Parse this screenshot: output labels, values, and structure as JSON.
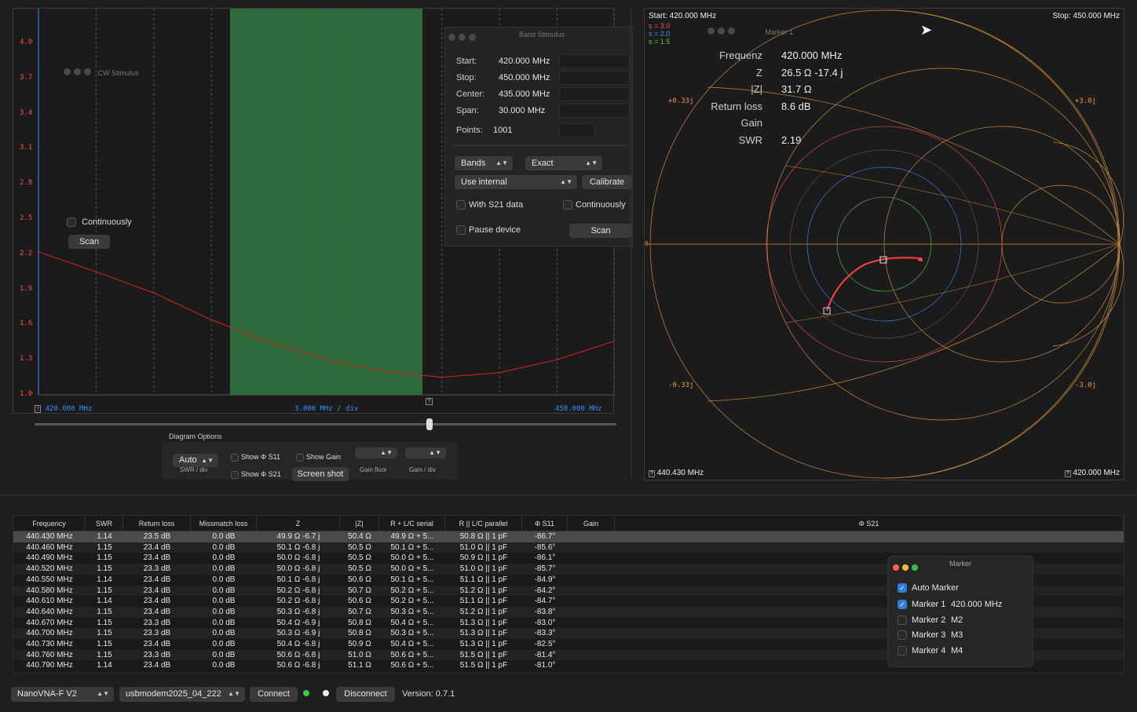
{
  "swr_chart": {
    "y_ticks": [
      "4.0",
      "3.7",
      "3.4",
      "3.1",
      "2.8",
      "2.5",
      "2.2",
      "1.9",
      "1.6",
      "1.3",
      "1.0"
    ],
    "start_label": "420.000 MHz",
    "div_label": "3.000 MHz / div",
    "stop_label": "450.000 MHz",
    "marker_glyph": "?",
    "trace_color": "#e02020",
    "band_color": "#2e6b3a"
  },
  "cw_stimulus": {
    "title": "CW Stimulus",
    "continuously_label": "Continuously",
    "scan_label": "Scan"
  },
  "band_stimulus": {
    "title": "Band Stimulus",
    "start_label": "Start:",
    "start_value": "420.000 MHz",
    "stop_label": "Stop:",
    "stop_value": "450.000 MHz",
    "center_label": "Center:",
    "center_value": "435.000 MHz",
    "span_label": "Span:",
    "span_value": "30.000 MHz",
    "points_label": "Points:",
    "points_value": "1001",
    "bands_select": "Bands",
    "exact_select": "Exact",
    "cal_select": "Use internal",
    "calibrate_label": "Calibrate",
    "s21_label": "With S21 data",
    "continuously_label": "Continuously",
    "pause_label": "Pause device",
    "scan_label": "Scan"
  },
  "diagram_options": {
    "title": "Diagram Options",
    "swr_select": "Auto",
    "swr_caption": "SWR / div",
    "show_s11": "Show Φ S11",
    "show_s21": "Show Φ S21",
    "show_gain": "Show Gain",
    "screenshot_label": "Screen shot",
    "gain_floor_caption": "Gain floor",
    "gain_div_caption": "Gain / div"
  },
  "smith": {
    "start_text": "Start: 420.000 MHz",
    "stop_text": "Stop: 450.000 MHz",
    "s_circles": [
      "s = 3.0",
      "s = 2.0",
      "s = 1.5"
    ],
    "s_colors": [
      "#ff5050",
      "#3d8cff",
      "#4ccf4c"
    ],
    "ticks": [
      "+0.33j",
      "+3.0j",
      "-0.33j",
      "-3.0j",
      "0"
    ],
    "bottom_left": "440.430 MHz",
    "bottom_right": "420.000 MHz",
    "marker_window_title": "Marker 1",
    "readout": [
      {
        "label": "Frequenz",
        "value": "420.000 MHz"
      },
      {
        "label": "Z",
        "value": "26.5 Ω -17.4 j"
      },
      {
        "label": "|Z|",
        "value": "31.7 Ω"
      },
      {
        "label": "Return loss",
        "value": "8.6 dB"
      },
      {
        "label": "Gain",
        "value": ""
      },
      {
        "label": "SWR",
        "value": "2.19"
      }
    ]
  },
  "table": {
    "headers": [
      "Frequency",
      "SWR",
      "Return loss",
      "Missmatch loss",
      "Z",
      "|Z|",
      "R + L/C serial",
      "R || L/C parallel",
      "Φ S11",
      "Gain",
      "Φ S21"
    ],
    "rows": [
      [
        "440.430 MHz",
        "1.14",
        "23.5 dB",
        "0.0 dB",
        "49.9 Ω -6.7 j",
        "50.4 Ω",
        "49.9 Ω + 5...",
        "50.8 Ω || 1 pF",
        "-86.7°"
      ],
      [
        "440.460 MHz",
        "1.15",
        "23.4 dB",
        "0.0 dB",
        "50.1 Ω -6.8 j",
        "50.5 Ω",
        "50.1 Ω + 5...",
        "51.0 Ω || 1 pF",
        "-85.6°"
      ],
      [
        "440.490 MHz",
        "1.15",
        "23.4 dB",
        "0.0 dB",
        "50.0 Ω -6.8 j",
        "50.5 Ω",
        "50.0 Ω + 5...",
        "50.9 Ω || 1 pF",
        "-86.1°"
      ],
      [
        "440.520 MHz",
        "1.15",
        "23.3 dB",
        "0.0 dB",
        "50.0 Ω -6.8 j",
        "50.5 Ω",
        "50.0 Ω + 5...",
        "51.0 Ω || 1 pF",
        "-85.7°"
      ],
      [
        "440.550 MHz",
        "1.14",
        "23.4 dB",
        "0.0 dB",
        "50.1 Ω -6.8 j",
        "50.6 Ω",
        "50.1 Ω + 5...",
        "51.1 Ω || 1 pF",
        "-84.9°"
      ],
      [
        "440.580 MHz",
        "1.15",
        "23.4 dB",
        "0.0 dB",
        "50.2 Ω -6.8 j",
        "50.7 Ω",
        "50.2 Ω + 5...",
        "51.2 Ω || 1 pF",
        "-84.2°"
      ],
      [
        "440.610 MHz",
        "1.14",
        "23.4 dB",
        "0.0 dB",
        "50.2 Ω -6.8 j",
        "50.6 Ω",
        "50.2 Ω + 5...",
        "51.1 Ω || 1 pF",
        "-84.7°"
      ],
      [
        "440.640 MHz",
        "1.15",
        "23.4 dB",
        "0.0 dB",
        "50.3 Ω -6.8 j",
        "50.7 Ω",
        "50.3 Ω + 5...",
        "51.2 Ω || 1 pF",
        "-83.8°"
      ],
      [
        "440.670 MHz",
        "1.15",
        "23.3 dB",
        "0.0 dB",
        "50.4 Ω -6.9 j",
        "50.8 Ω",
        "50.4 Ω + 5...",
        "51.3 Ω || 1 pF",
        "-83.0°"
      ],
      [
        "440.700 MHz",
        "1.15",
        "23.3 dB",
        "0.0 dB",
        "50.3 Ω -6.9 j",
        "50.8 Ω",
        "50.3 Ω + 5...",
        "51.3 Ω || 1 pF",
        "-83.3°"
      ],
      [
        "440.730 MHz",
        "1.15",
        "23.4 dB",
        "0.0 dB",
        "50.4 Ω -6.8 j",
        "50.9 Ω",
        "50.4 Ω + 5...",
        "51.3 Ω || 1 pF",
        "-82.5°"
      ],
      [
        "440.760 MHz",
        "1.15",
        "23.3 dB",
        "0.0 dB",
        "50.6 Ω -6.8 j",
        "51.0 Ω",
        "50.6 Ω + 5...",
        "51.5 Ω || 1 pF",
        "-81.4°"
      ],
      [
        "440.790 MHz",
        "1.14",
        "23.4 dB",
        "0.0 dB",
        "50.6 Ω -6.8 j",
        "51.1 Ω",
        "50.6 Ω + 5...",
        "51.5 Ω || 1 pF",
        "-81.0°"
      ]
    ]
  },
  "marker_window": {
    "title": "Marker",
    "auto_label": "Auto Marker",
    "markers": [
      {
        "label": "Marker 1",
        "value": "420.000 MHz",
        "checked": true
      },
      {
        "label": "Marker 2",
        "value": "M2",
        "checked": false
      },
      {
        "label": "Marker 3",
        "value": "M3",
        "checked": false
      },
      {
        "label": "Marker 4",
        "value": "M4",
        "checked": false
      }
    ]
  },
  "bottom_bar": {
    "device_select": "NanoVNA-F V2",
    "port_select": "usbmodem2025_04_222",
    "connect_label": "Connect",
    "disconnect_label": "Disconnect",
    "version_text": "Version: 0.7.1"
  }
}
